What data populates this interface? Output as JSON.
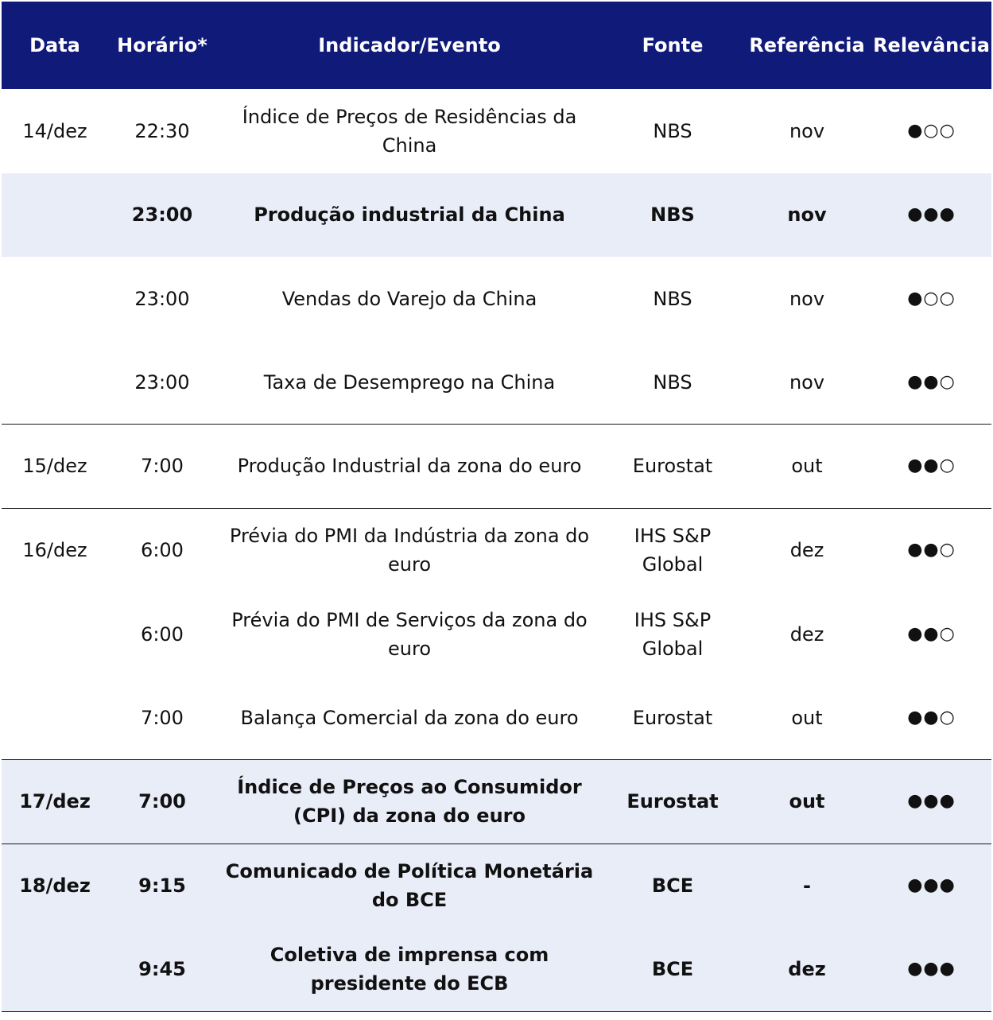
{
  "headers": {
    "date": "Data",
    "time": "Horário*",
    "indicator": "Indicador/Evento",
    "source": "Fonte",
    "reference": "Referência",
    "relevance": "Relevância"
  },
  "rows": [
    {
      "date": "14/dez",
      "time": "22:30",
      "indicator": "Índice de Preços de Residências da China",
      "source": "NBS",
      "reference": "nov",
      "relevance": "●○○"
    },
    {
      "date": "",
      "time": "23:00",
      "indicator": "Produção industrial da China",
      "source": "NBS",
      "reference": "nov",
      "relevance": "●●●"
    },
    {
      "date": "",
      "time": "23:00",
      "indicator": "Vendas do Varejo da China",
      "source": "NBS",
      "reference": "nov",
      "relevance": "●○○"
    },
    {
      "date": "",
      "time": "23:00",
      "indicator": "Taxa de Desemprego na China",
      "source": "NBS",
      "reference": "nov",
      "relevance": "●●○"
    },
    {
      "date": "15/dez",
      "time": "7:00",
      "indicator": "Produção Industrial da zona do euro",
      "source": "Eurostat",
      "reference": "out",
      "relevance": "●●○"
    },
    {
      "date": "16/dez",
      "time": "6:00",
      "indicator": "Prévia do PMI da Indústria da zona do euro",
      "source": "IHS S&P Global",
      "reference": "dez",
      "relevance": "●●○"
    },
    {
      "date": "",
      "time": "6:00",
      "indicator": "Prévia do PMI de Serviços da zona do euro",
      "source": "IHS S&P Global",
      "reference": "dez",
      "relevance": "●●○"
    },
    {
      "date": "",
      "time": "7:00",
      "indicator": "Balança Comercial da zona do euro",
      "source": "Eurostat",
      "reference": "out",
      "relevance": "●●○"
    },
    {
      "date": "17/dez",
      "time": "7:00",
      "indicator": "Índice de Preços ao Consumidor (CPI) da zona do euro",
      "source": "Eurostat",
      "reference": "out",
      "relevance": "●●●"
    },
    {
      "date": "18/dez",
      "time": "9:15",
      "indicator": "Comunicado de Política Monetária do BCE",
      "source": "BCE",
      "reference": "-",
      "relevance": "●●●"
    },
    {
      "date": "",
      "time": "9:45",
      "indicator": "Coletiva de imprensa com presidente do ECB",
      "source": "BCE",
      "reference": "dez",
      "relevance": "●●●"
    }
  ]
}
